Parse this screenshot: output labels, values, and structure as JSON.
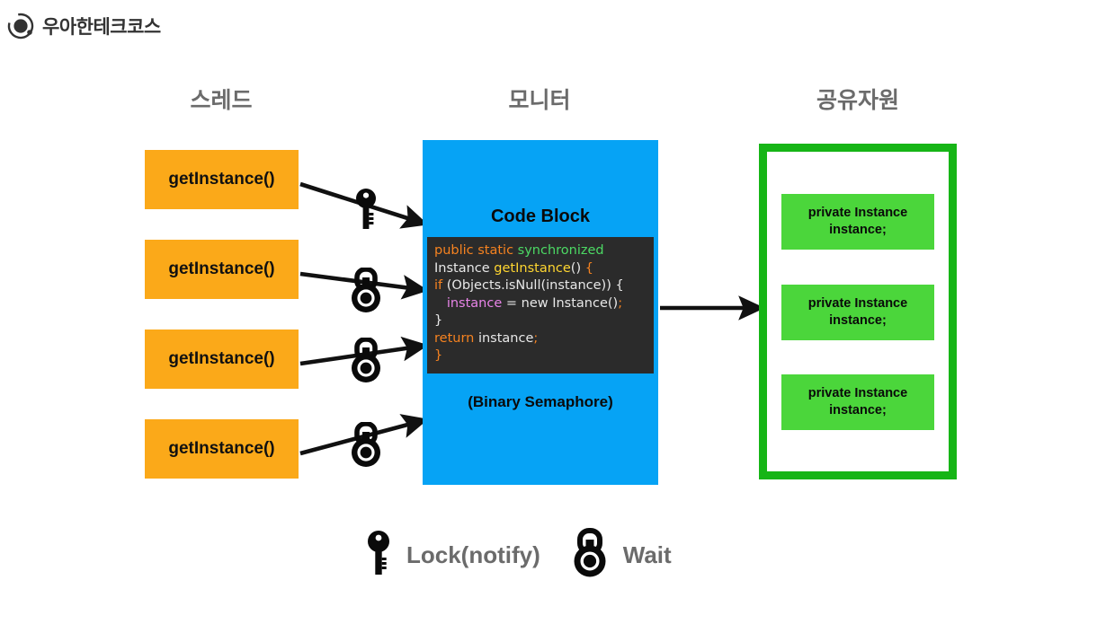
{
  "brand": {
    "name": "우아한테크코스",
    "logo_icon": "circle-dot-logo-icon"
  },
  "columns": {
    "thread": "스레드",
    "monitor": "모니터",
    "resource": "공유자원"
  },
  "threads": [
    {
      "label": "getInstance()",
      "gate_icon": "key-icon"
    },
    {
      "label": "getInstance()",
      "gate_icon": "padlock-icon"
    },
    {
      "label": "getInstance()",
      "gate_icon": "padlock-icon"
    },
    {
      "label": "getInstance()",
      "gate_icon": "padlock-icon"
    }
  ],
  "monitor": {
    "title": "Code Block",
    "subtitle": "(Binary Semaphore)",
    "panel_color": "#06A3F5",
    "code": {
      "background": "#2b2b2b",
      "lines": [
        [
          {
            "t": "public static ",
            "c": "kw"
          },
          {
            "t": "synchronized",
            "c": "sync"
          }
        ],
        [
          {
            "t": "Instance ",
            "c": "plain"
          },
          {
            "t": "getInstance",
            "c": "fn"
          },
          {
            "t": "() ",
            "c": "plain"
          },
          {
            "t": "{",
            "c": "punc"
          }
        ],
        [
          {
            "t": "if ",
            "c": "kw"
          },
          {
            "t": "(Objects.isNull(instance)) {",
            "c": "plain"
          }
        ],
        [
          {
            "t": "   ",
            "c": "plain"
          },
          {
            "t": "instance",
            "c": "var"
          },
          {
            "t": " = new Instance()",
            "c": "plain"
          },
          {
            "t": ";",
            "c": "punc"
          }
        ],
        [
          {
            "t": "}",
            "c": "plain"
          }
        ],
        [
          {
            "t": "return ",
            "c": "kw"
          },
          {
            "t": "instance",
            "c": "plain"
          },
          {
            "t": ";",
            "c": "punc"
          }
        ],
        [
          {
            "t": "}",
            "c": "punc"
          }
        ]
      ]
    }
  },
  "resource": {
    "border_color": "#16B516",
    "box_color": "#4BD63B",
    "items": [
      {
        "line1": "private Instance",
        "line2": "instance;"
      },
      {
        "line1": "private Instance",
        "line2": "instance;"
      },
      {
        "line1": "private Instance",
        "line2": "instance;"
      }
    ]
  },
  "legend": [
    {
      "icon": "key-icon",
      "label": "Lock(notify)"
    },
    {
      "icon": "padlock-icon",
      "label": "Wait"
    }
  ],
  "colors": {
    "thread_box": "#FBA919",
    "monitor": "#06A3F5",
    "resource_border": "#16B516",
    "resource_box": "#4BD63B",
    "heading": "#6b6b6b",
    "arrow": "#111111"
  }
}
